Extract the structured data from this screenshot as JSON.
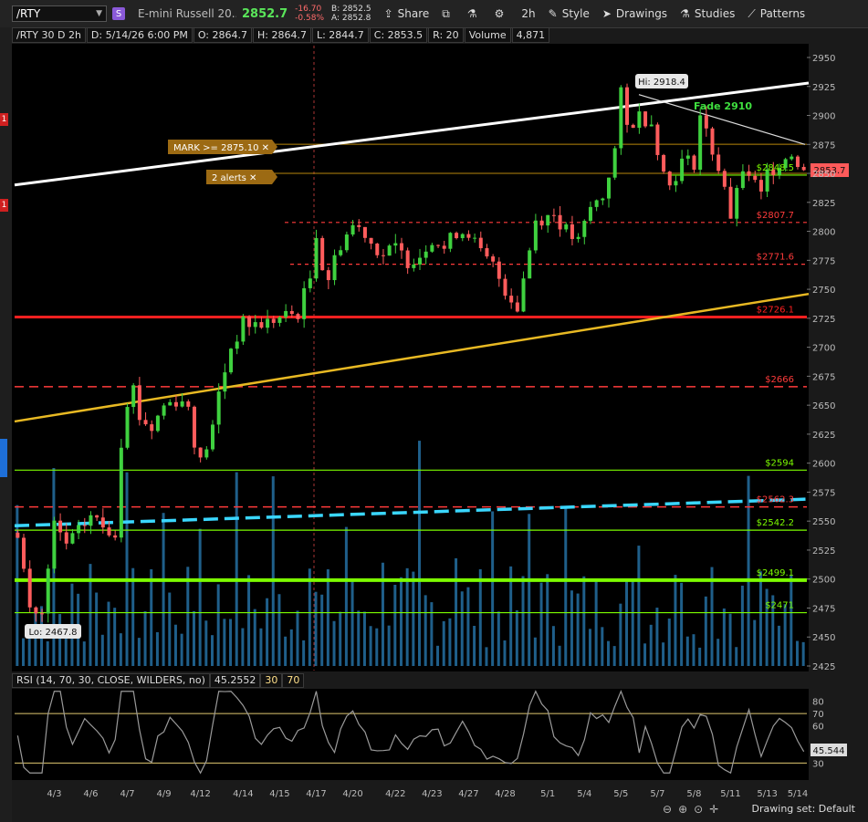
{
  "toolbar": {
    "symbol": "/RTY",
    "symbol_badge": "S",
    "description": "E-mini Russell 20...",
    "last": "2852.7",
    "change": "-16.70",
    "change_pct": "-0.58%",
    "bid": "B: 2852.5",
    "ask": "A: 2852.8",
    "share_label": "Share",
    "aggregation_label": "2h",
    "style_label": "Style",
    "drawings_label": "Drawings",
    "studies_label": "Studies",
    "patterns_label": "Patterns"
  },
  "infobar": {
    "title": "/RTY 30 D 2h",
    "date": "D: 5/14/26 6:00 PM",
    "open": "O: 2864.7",
    "high": "H: 2864.7",
    "low": "L: 2844.7",
    "close": "C: 2853.5",
    "range": "R: 20",
    "volume_label": "Volume",
    "volume": "4,871"
  },
  "leftrail": {
    "marker": "1"
  },
  "chart_data": {
    "type": "candlestick",
    "ylim": [
      2425,
      2960
    ],
    "y_ticks": [
      2425,
      2450,
      2475,
      2500,
      2525,
      2550,
      2575,
      2600,
      2625,
      2650,
      2675,
      2700,
      2725,
      2750,
      2775,
      2800,
      2825,
      2850,
      2875,
      2900,
      2925,
      2950
    ],
    "x_ticks": [
      {
        "label": "4/3",
        "i": 6
      },
      {
        "label": "4/6",
        "i": 12
      },
      {
        "label": "4/7",
        "i": 18
      },
      {
        "label": "4/9",
        "i": 24
      },
      {
        "label": "4/12",
        "i": 30
      },
      {
        "label": "4/14",
        "i": 37
      },
      {
        "label": "4/15",
        "i": 43
      },
      {
        "label": "4/17",
        "i": 49
      },
      {
        "label": "4/20",
        "i": 55
      },
      {
        "label": "4/22",
        "i": 62
      },
      {
        "label": "4/23",
        "i": 68
      },
      {
        "label": "4/27",
        "i": 74
      },
      {
        "label": "4/28",
        "i": 80
      },
      {
        "label": "5/1",
        "i": 87
      },
      {
        "label": "5/4",
        "i": 93
      },
      {
        "label": "5/5",
        "i": 99
      },
      {
        "label": "5/7",
        "i": 105
      },
      {
        "label": "5/8",
        "i": 111
      },
      {
        "label": "5/11",
        "i": 117
      },
      {
        "label": "5/13",
        "i": 123
      },
      {
        "label": "5/14",
        "i": 128
      }
    ],
    "path": [
      [
        0,
        2540
      ],
      [
        2,
        2475
      ],
      [
        4,
        2468
      ],
      [
        6,
        2545
      ],
      [
        8,
        2530
      ],
      [
        10,
        2540
      ],
      [
        12,
        2555
      ],
      [
        14,
        2545
      ],
      [
        16,
        2540
      ],
      [
        17,
        2620
      ],
      [
        18,
        2655
      ],
      [
        19,
        2665
      ],
      [
        20,
        2640
      ],
      [
        22,
        2630
      ],
      [
        24,
        2650
      ],
      [
        26,
        2655
      ],
      [
        28,
        2650
      ],
      [
        29,
        2620
      ],
      [
        30,
        2600
      ],
      [
        32,
        2630
      ],
      [
        33,
        2660
      ],
      [
        35,
        2700
      ],
      [
        37,
        2720
      ],
      [
        40,
        2720
      ],
      [
        43,
        2725
      ],
      [
        46,
        2730
      ],
      [
        48,
        2760
      ],
      [
        49,
        2800
      ],
      [
        50,
        2770
      ],
      [
        51,
        2760
      ],
      [
        53,
        2790
      ],
      [
        55,
        2805
      ],
      [
        57,
        2800
      ],
      [
        58,
        2790
      ],
      [
        60,
        2780
      ],
      [
        62,
        2785
      ],
      [
        64,
        2775
      ],
      [
        66,
        2780
      ],
      [
        68,
        2795
      ],
      [
        70,
        2785
      ],
      [
        72,
        2800
      ],
      [
        74,
        2800
      ],
      [
        76,
        2780
      ],
      [
        78,
        2770
      ],
      [
        80,
        2750
      ],
      [
        82,
        2735
      ],
      [
        83,
        2760
      ],
      [
        85,
        2810
      ],
      [
        88,
        2815
      ],
      [
        90,
        2800
      ],
      [
        92,
        2790
      ],
      [
        94,
        2820
      ],
      [
        96,
        2830
      ],
      [
        98,
        2870
      ],
      [
        99,
        2918
      ],
      [
        100,
        2890
      ],
      [
        102,
        2900
      ],
      [
        104,
        2895
      ],
      [
        106,
        2850
      ],
      [
        107,
        2840
      ],
      [
        109,
        2860
      ],
      [
        111,
        2860
      ],
      [
        112,
        2900
      ],
      [
        114,
        2870
      ],
      [
        116,
        2840
      ],
      [
        117,
        2805
      ],
      [
        118,
        2840
      ],
      [
        120,
        2850
      ],
      [
        122,
        2830
      ],
      [
        123,
        2850
      ],
      [
        125,
        2860
      ],
      [
        127,
        2868
      ],
      [
        129,
        2853
      ]
    ],
    "hi_label": "Hi: 2918.4",
    "lo_label": "Lo: 2467.8",
    "price_tag": "2853.7",
    "levels": [
      {
        "label": "$2807.7",
        "y": 2807.7,
        "color": "#ff3b3b",
        "style": "dotted"
      },
      {
        "label": "$2771.6",
        "y": 2771.6,
        "color": "#ff3b3b",
        "style": "dotted"
      },
      {
        "label": "$2726.1",
        "y": 2726.1,
        "color": "#ff2020",
        "style": "solid"
      },
      {
        "label": "$2666",
        "y": 2666,
        "color": "#ff3b3b",
        "style": "dashed"
      },
      {
        "label": "$2594",
        "y": 2594,
        "color": "#7cfc00",
        "style": "solid"
      },
      {
        "label": "$2562.3",
        "y": 2562.3,
        "color": "#ff3b3b",
        "style": "dashed"
      },
      {
        "label": "$2542.2",
        "y": 2542.2,
        "color": "#7cfc00",
        "style": "solid"
      },
      {
        "label": "$2499.1",
        "y": 2499.1,
        "color": "#7cfc00",
        "style": "thick"
      },
      {
        "label": "$2471",
        "y": 2471,
        "color": "#7cfc00",
        "style": "solid"
      },
      {
        "label": "$2848.5",
        "y": 2848.5,
        "color": "#7cfc00",
        "style": "solid"
      }
    ],
    "alerts": [
      {
        "label": "MARK >= 2875.10",
        "y": 2875.1
      },
      {
        "label": "2 alerts",
        "y": 2850
      }
    ],
    "annotation": "Fade 2910",
    "rsi": {
      "label": "RSI (14, 70, 30, CLOSE, WILDERS, no)",
      "value": "45.2552",
      "ob": "30",
      "os": "70",
      "last_tag": "45.544",
      "ticks": [
        "80",
        "70",
        "60",
        "30"
      ]
    }
  },
  "status": {
    "drawing_set": "Drawing set: Default"
  }
}
